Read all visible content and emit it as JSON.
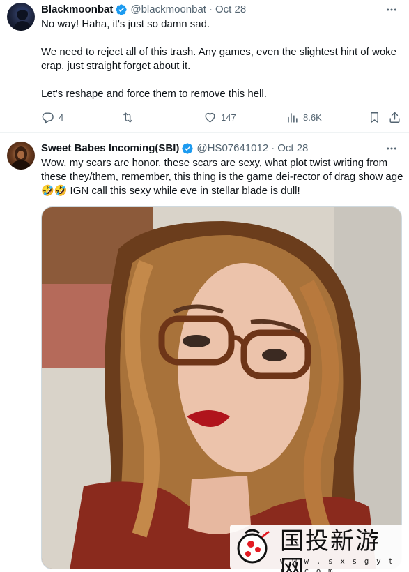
{
  "tweets": [
    {
      "display_name": "Blackmoonbat",
      "handle": "@blackmoonbat",
      "separator": "·",
      "date": "Oct 28",
      "text": "No way! Haha, it's just so damn sad.\n\nWe need to reject all of this trash. Any games, even the slightest hint of woke crap, just straight forget about it.\n\nLet's reshape and force them to remove this hell.",
      "replies": "4",
      "retweets": "",
      "likes": "147",
      "views": "8.6K"
    },
    {
      "display_name": "Sweet Babes Incoming(SBI)",
      "handle": "@HS07641012",
      "separator": "·",
      "date": "Oct 28",
      "text": "Wow, my scars are honor, these scars are sexy, what plot twist writing from these they/them, remember, this thing is the game dei-rector of drag show age 🤣🤣 IGN call this sexy while eve in stellar blade is dull!"
    }
  ],
  "watermark": {
    "title": "国投新游网",
    "url": "w w w . s x s g y t r . c o m"
  },
  "colors": {
    "verified_blue": "#1d9bf0",
    "secondary_text": "#536471",
    "primary_text": "#0f1419"
  }
}
